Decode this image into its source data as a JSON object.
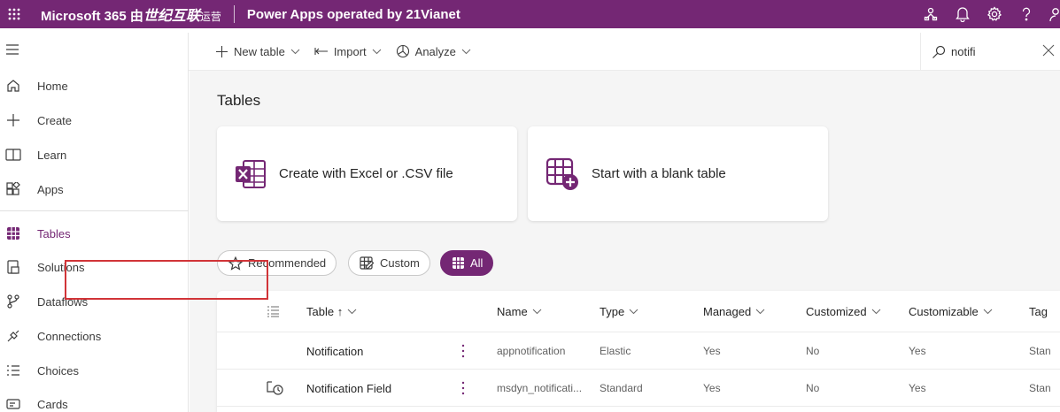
{
  "header": {
    "brand_prefix": "Microsoft 365 由",
    "brand_cn": "世纪互联",
    "brand_suffix": "运营",
    "app_title": "Power Apps operated by 21Vianet",
    "bg_color": "#742774"
  },
  "nav": {
    "items": [
      {
        "label": "Home",
        "icon": "home-icon"
      },
      {
        "label": "Create",
        "icon": "plus-icon"
      },
      {
        "label": "Learn",
        "icon": "book-icon"
      },
      {
        "label": "Apps",
        "icon": "apps-icon"
      },
      {
        "label": "Tables",
        "icon": "table-grid-icon",
        "active": true
      },
      {
        "label": "Solutions",
        "icon": "solutions-icon"
      },
      {
        "label": "Dataflows",
        "icon": "dataflows-icon"
      },
      {
        "label": "Connections",
        "icon": "connections-icon"
      },
      {
        "label": "Choices",
        "icon": "choices-icon"
      },
      {
        "label": "Cards",
        "icon": "cards-icon"
      }
    ]
  },
  "commandbar": {
    "new_table": "New table",
    "import": "Import",
    "analyze": "Analyze",
    "search_value": "notifi"
  },
  "main": {
    "title": "Tables",
    "cards": [
      {
        "label": "Create with Excel or .CSV file",
        "icon": "excel-icon"
      },
      {
        "label": "Start with a blank table",
        "icon": "blank-table-icon"
      }
    ],
    "filters": [
      {
        "label": "Recommended",
        "icon": "star-icon"
      },
      {
        "label": "Custom",
        "icon": "custom-table-icon"
      },
      {
        "label": "All",
        "icon": "all-grid-icon",
        "active": true
      }
    ],
    "columns": [
      "Table ↑",
      "Name",
      "Type",
      "Managed",
      "Customized",
      "Customizable",
      "Tag"
    ],
    "rows": [
      {
        "table": "Notification",
        "name": "appnotification",
        "type": "Elastic",
        "managed": "Yes",
        "customized": "No",
        "customizable": "Yes",
        "tag": "Stan"
      },
      {
        "table": "Notification Field",
        "name": "msdyn_notificati...",
        "type": "Standard",
        "managed": "Yes",
        "customized": "No",
        "customizable": "Yes",
        "tag": "Stan"
      }
    ]
  },
  "colors": {
    "accent": "#742774",
    "highlight_border": "#d13438"
  }
}
